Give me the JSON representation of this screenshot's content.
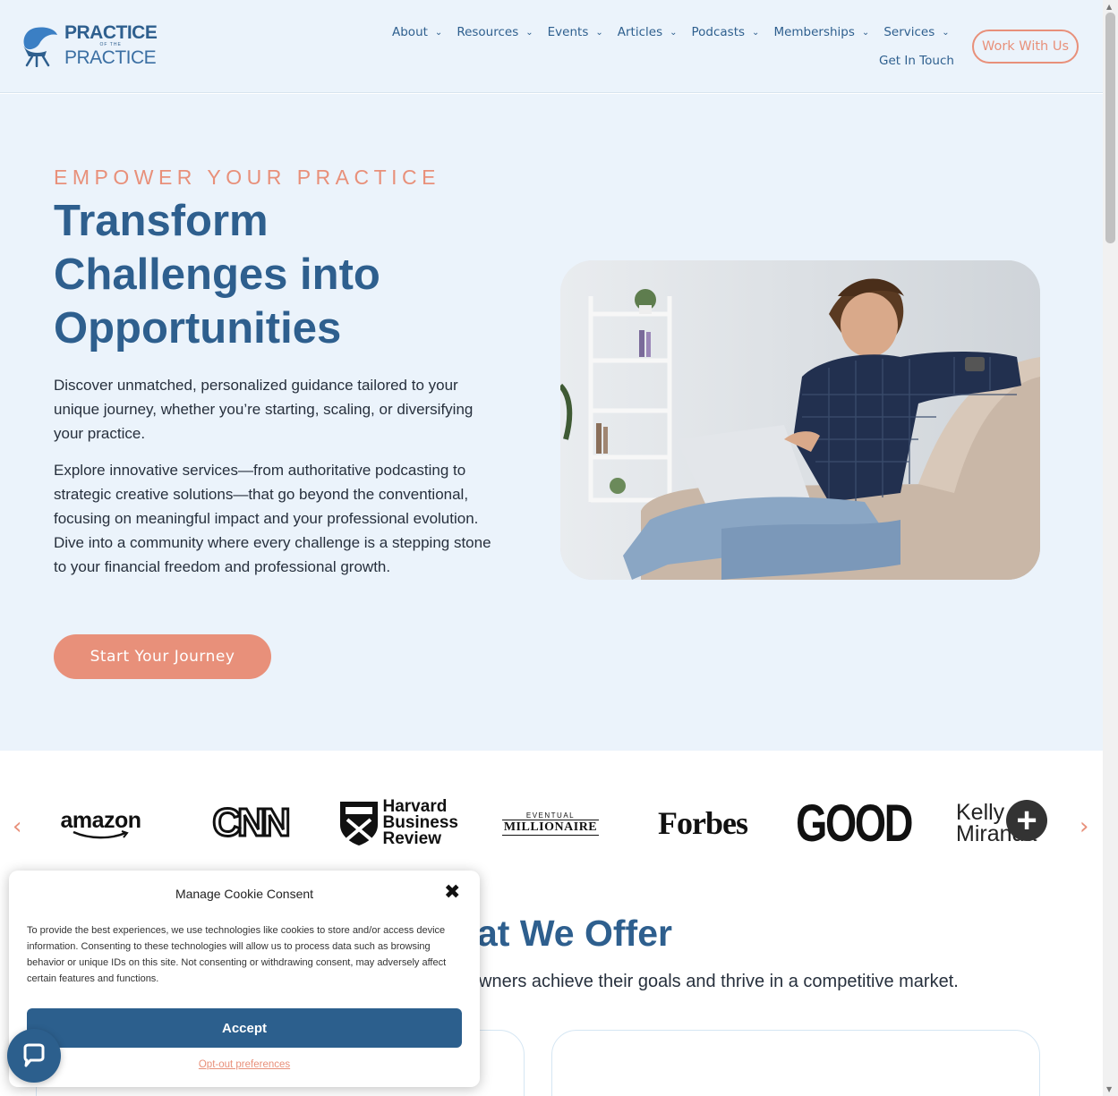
{
  "header": {
    "logo": {
      "top": "PRACTICE",
      "mid": "OF THE",
      "bottom": "PRACTICE"
    },
    "nav": [
      {
        "label": "About",
        "has_dropdown": true
      },
      {
        "label": "Resources",
        "has_dropdown": true
      },
      {
        "label": "Events",
        "has_dropdown": true
      },
      {
        "label": "Articles",
        "has_dropdown": true
      },
      {
        "label": "Podcasts",
        "has_dropdown": true
      },
      {
        "label": "Memberships",
        "has_dropdown": true
      },
      {
        "label": "Services",
        "has_dropdown": true
      },
      {
        "label": "Get In Touch",
        "has_dropdown": false
      }
    ],
    "cta_label": "Work With Us"
  },
  "hero": {
    "eyebrow": "EMPOWER YOUR PRACTICE",
    "title": "Transform Challenges into Opportunities",
    "paragraph1": "Discover unmatched, personalized guidance tailored to your unique journey, whether you’re starting, scaling, or diversifying your practice.",
    "paragraph2": "Explore innovative services—from authoritative podcasting to strategic creative solutions—that go beyond the conventional, focusing on meaningful impact and your professional evolution. Dive into a community where every challenge is a stepping stone to your financial freedom and professional growth.",
    "cta_label": "Start Your Journey"
  },
  "logos": {
    "prev_icon": "chevron-left-icon",
    "next_icon": "chevron-right-icon",
    "brands": [
      {
        "name": "amazon",
        "text": "amazon"
      },
      {
        "name": "cnn",
        "text": "CNN"
      },
      {
        "name": "harvard-business-review",
        "text": "Harvard Business Review"
      },
      {
        "name": "eventual-millionaire",
        "text_small": "EVENTUAL",
        "text_main": "MILLIONAIRE"
      },
      {
        "name": "forbes",
        "text": "Forbes"
      },
      {
        "name": "good",
        "text": "GOOD"
      },
      {
        "name": "kelly-miranda",
        "line1": "Kelly",
        "line2": "Miranda"
      }
    ]
  },
  "offer": {
    "title": "at We Offer",
    "subtitle": "wners achieve their goals and thrive in a competitive market."
  },
  "cookie": {
    "title": "Manage Cookie Consent",
    "body": "To provide the best experiences, we use technologies like cookies to store and/or access device information. Consenting to these technologies will allow us to process data such as browsing behavior or unique IDs on this site. Not consenting or withdrawing consent, may adversely affect certain features and functions.",
    "accept_label": "Accept",
    "opt_out_label": "Opt-out preferences",
    "close_icon": "close-icon"
  },
  "chat": {
    "icon": "chat-bubble-icon"
  },
  "colors": {
    "primary": "#2e5f8e",
    "accent": "#e8907a",
    "hero_bg": "#ebf3fb",
    "button_dark": "#2c5f8d"
  }
}
